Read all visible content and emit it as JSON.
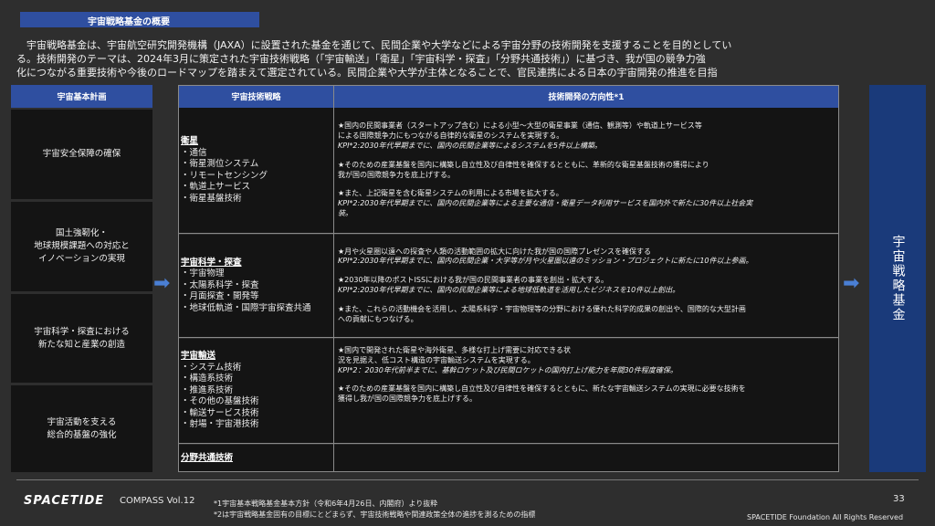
{
  "section_title": "宇宙戦略基金の概要",
  "intro": {
    "line1": "　宇宙戦略基金は、宇宙航空研究開発機構（JAXA）に設置された基金を通じて、民間企業や大学などによる宇宙分野の技術開発を支援することを目的としてい",
    "line2": "る。技術開発のテーマは、2024年3月に策定された宇宙技術戦略（「宇宙輸送」「衛星」「宇宙科学・探査」「分野共通技術」）に基づき、我が国の競争力強",
    "line3": "化につながる重要技術や今後のロードマップを踏まえて選定されている。民間企業や大学が主体となることで、官民連携による日本の宇宙開発の推進を目指"
  },
  "left": {
    "header": "宇宙基本計画",
    "items": [
      "宇宙安全保障の確保",
      "国土強靭化・\n地球規模課題への対応と\nイノベーションの実現",
      "宇宙科学・探査における\n新たな知と産業の創造",
      "宇宙活動を支える\n総合的基盤の強化"
    ]
  },
  "table": {
    "header_strategy": "宇宙技術戦略",
    "header_direction": "技術開発の方向性*1",
    "rows": [
      {
        "title": "衛星",
        "items": [
          "・通信",
          "・衛星測位システム",
          "・リモートセンシング",
          "・軌道上サービス",
          "・衛星基盤技術"
        ],
        "dir": [
          "★国内の民間事業者（スタートアップ含む）による小型〜大型の衛星事業（通信、観測等）や軌道上サービス等",
          "による国際競争力にもつながる自律的な衛星のシステムを実現する。",
          "KPI*2:2030年代早期までに、国内の民間企業等によるシステムを5件以上構築。",
          "",
          "★そのための産業基盤を国内に構築し自立性及び自律性を確保するとともに、革新的な衛星基盤技術の獲得により",
          "我が国の国際競争力を底上げする。",
          "",
          "★また、上記衛星を含む衛星システムの利用による市場を拡大する。",
          "KPI*2:2030年代早期までに、国内の民間企業等による主要な通信・衛星データ利用サービスを国内外で新たに30件以上社会実",
          "装。"
        ]
      },
      {
        "title": "宇宙科学・探査",
        "items": [
          "・宇宙物理",
          "・太陽系科学・探査",
          "・月面探査・開発等",
          "・地球低軌道・国際宇宙探査共通"
        ],
        "dir": [
          "★月や火星圏以遠への探査や人類の活動範囲の拡大に向けた我が国の国際プレゼンスを確保する",
          "KPI*2:2030年代早期までに、国内の民間企業・大学等が月や火星圏以遠のミッション・プロジェクトに新たに10件以上参画。",
          "",
          "★2030年以降のポストISSにおける我が国の民間事業者の事業を創出・拡大する。",
          "KPI*2:2030年代早期までに、国内の民間企業等による地球低軌道を活用したビジネスを10件以上創出。",
          "",
          "★また、これらの活動機会を活用し、太陽系科学・宇宙物理等の分野における優れた科学的成果の創出や、国際的な大型計画",
          "への貢献にもつなげる。"
        ]
      },
      {
        "title": "宇宙輸送",
        "items": [
          "・システム技術",
          "・構造系技術",
          "・推進系技術",
          "・その他の基盤技術",
          "・輸送サービス技術",
          "・射場・宇宙港技術"
        ],
        "dir": [
          "★国内で開発された衛星や海外衛星、多様な打上げ需要に対応できる状",
          "況を見据え、低コスト構造の宇宙輸送システムを実現する。",
          "KPI*2：2030年代前半までに、基幹ロケット及び民間ロケットの国内打上げ能力を年間30件程度確保。",
          "",
          "★そのための産業基盤を国内に構築し自立性及び自律性を確保するとともに、新たな宇宙輸送システムの実現に必要な技術を",
          "獲得し我が国の国際競争力を底上げする。"
        ]
      },
      {
        "title": "分野共通技術",
        "items": [],
        "dir": []
      }
    ]
  },
  "right_box": "宇宙戦略基金",
  "footer": {
    "logo": "SPACETIDE",
    "volume": "COMPASS Vol.12",
    "note1": "*1宇宙基本戦略基金基本方針（令和6年4月26日、内閣府）より抜粋",
    "note2": "*2は宇宙戦略基金固有の目標にとどまらず、宇宙技術戦略や関連政策全体の進捗を測るための指標",
    "page_number": "33",
    "rights": "SPACETIDE Foundation All Rights Reserved"
  },
  "colors": {
    "background": "#2e2e2e",
    "header_blue": "#2f4fa0",
    "right_box_blue": "#1a3a7a",
    "arrow_blue": "#4a7fd4",
    "cell_black": "#141414"
  },
  "icons": [
    "arrow-right-icon",
    "arrow-right-icon"
  ]
}
